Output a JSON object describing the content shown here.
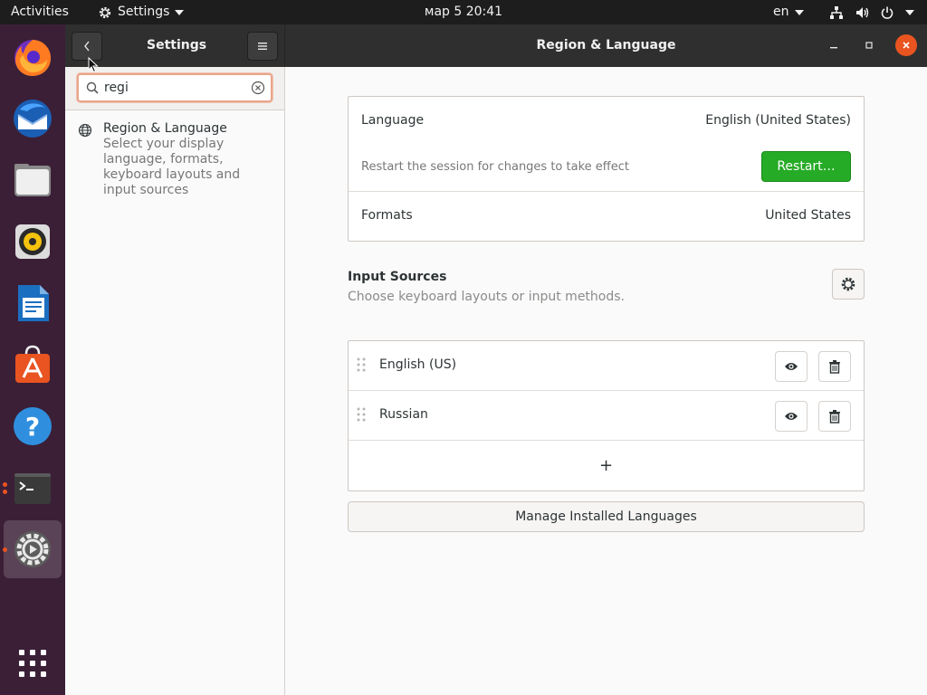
{
  "topbar": {
    "activities": "Activities",
    "app_name": "Settings",
    "clock": "мар 5  20:41",
    "language": "en"
  },
  "dock": {
    "items": [
      {
        "name": "firefox-icon"
      },
      {
        "name": "thunderbird-icon"
      },
      {
        "name": "files-icon"
      },
      {
        "name": "rhythmbox-icon"
      },
      {
        "name": "libreoffice-writer-icon"
      },
      {
        "name": "ubuntu-software-icon"
      },
      {
        "name": "help-icon"
      },
      {
        "name": "terminal-icon"
      },
      {
        "name": "settings-icon"
      },
      {
        "name": "show-applications-icon"
      }
    ]
  },
  "window": {
    "left_title": "Settings",
    "title": "Region & Language"
  },
  "sidebar": {
    "search_value": "regi",
    "results": [
      {
        "title": "Region & Language",
        "description": "Select your display language, formats, keyboard layouts and input sources"
      }
    ]
  },
  "language_panel": {
    "language_label": "Language",
    "language_value": "English (United States)",
    "restart_note": "Restart the session for changes to take effect",
    "restart_button": "Restart…",
    "formats_label": "Formats",
    "formats_value": "United States"
  },
  "input_sources": {
    "title": "Input Sources",
    "subtitle": "Choose keyboard layouts or input methods.",
    "items": [
      {
        "label": "English (US)"
      },
      {
        "label": "Russian"
      }
    ],
    "add_label": "+"
  },
  "manage_button": "Manage Installed Languages",
  "colors": {
    "accent": "#e95420",
    "restart_green": "#26ab26",
    "dock_bg": "#3b1f37",
    "headerbar": "#2f2f2f"
  }
}
